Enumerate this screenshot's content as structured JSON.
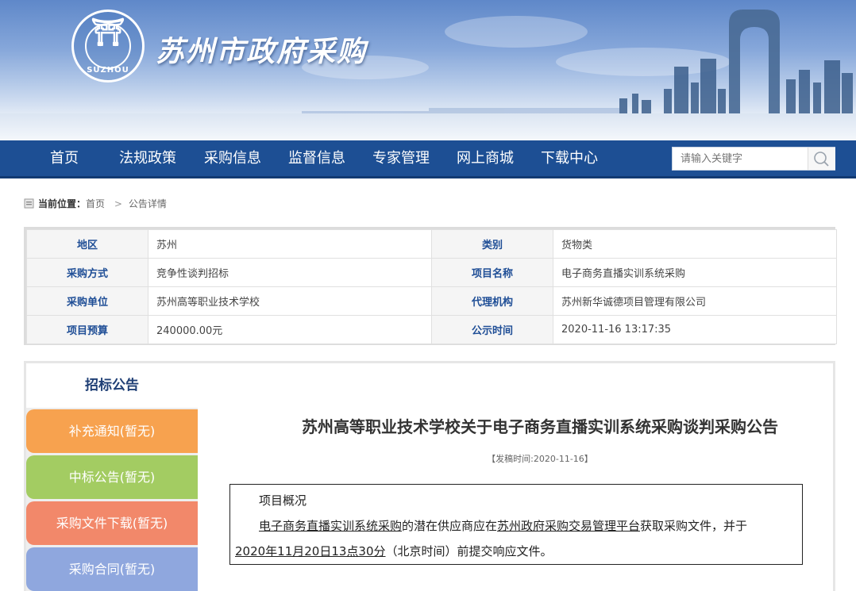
{
  "header": {
    "site_title": "苏州市政府采购",
    "logo_text": "SUZHOU"
  },
  "nav": {
    "items": [
      "首页",
      "法规政策",
      "采购信息",
      "监督信息",
      "专家管理",
      "网上商城",
      "下载中心"
    ]
  },
  "search": {
    "placeholder": "请输入关键字",
    "icon": "search-icon"
  },
  "breadcrumb": {
    "prefix": "当前位置：",
    "home": "首页",
    "separator": ">",
    "current": "公告详情"
  },
  "info": {
    "rows": [
      {
        "label1": "地区",
        "value1": "苏州",
        "label2": "类别",
        "value2": "货物类"
      },
      {
        "label1": "采购方式",
        "value1": "竞争性谈判招标",
        "label2": "项目名称",
        "value2": "电子商务直播实训系统采购"
      },
      {
        "label1": "采购单位",
        "value1": "苏州高等职业技术学校",
        "label2": "代理机构",
        "value2": "苏州新华诚德项目管理有限公司"
      },
      {
        "label1": "项目预算",
        "value1": "240000.00元",
        "label2": "公示时间",
        "value2": "2020-11-16 13:17:35"
      }
    ]
  },
  "sidebar": {
    "active": "招标公告",
    "tabs": [
      {
        "label": "补充通知(暂无)",
        "color": "#f7a24f"
      },
      {
        "label": "中标公告(暂无)",
        "color": "#a3cc62"
      },
      {
        "label": "采购文件下载(暂无)",
        "color": "#f2886a"
      },
      {
        "label": "采购合同(暂无)",
        "color": "#8fa7de"
      }
    ]
  },
  "article": {
    "title": "苏州高等职业技术学校关于电子商务直播实训系统采购谈判采购公告",
    "date": "【发稿时间:2020-11-16】",
    "overview": "项目概况",
    "p_link1": "电子商务直播实训系统采购",
    "p_text1": "的潜在供应商应在",
    "p_link2": "苏州政府采购交易管理平台",
    "p_text2": "获取采购文件，并于",
    "p_link3": "2020年11月20日13点30分",
    "p_text3": "（北京时间）前提交响应文件。"
  }
}
